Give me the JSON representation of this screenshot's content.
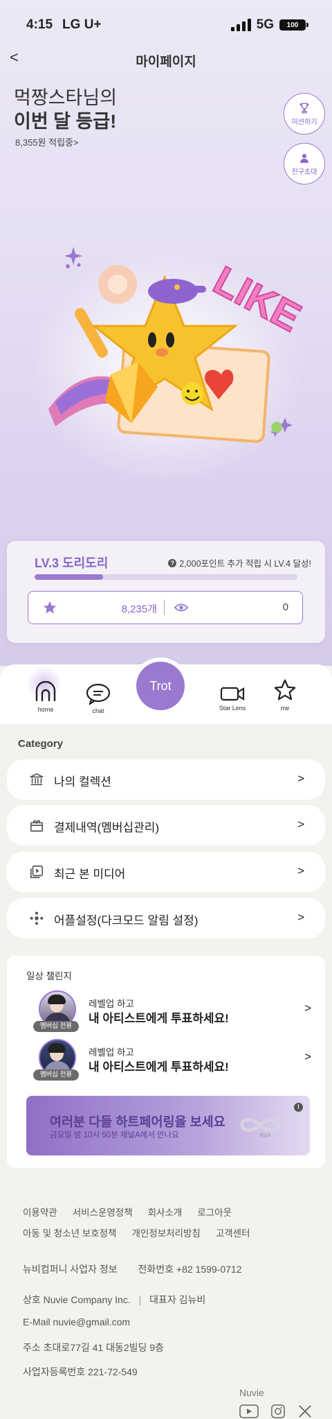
{
  "status_bar": {
    "time": "4:15",
    "carrier": "LG U+",
    "network": "5G",
    "battery": "100"
  },
  "header": {
    "back": "<",
    "title": "마이페이지"
  },
  "hero": {
    "greeting_line1": "먹짱스타님의",
    "greeting_line2": "이번 달 등급!",
    "points": "8,355원 적립중>",
    "mission_button": "미션하기",
    "invite_button": "친구초대"
  },
  "level": {
    "title": "LV.3 도리도리",
    "note": "2,000포인트 추가 적립 시 LV.4 달성!",
    "progress_fraction": 0.26,
    "star_count": "8,235개",
    "view_count": "0"
  },
  "tabbar": {
    "home": "home",
    "chat": "chat",
    "center": "Trot",
    "star_lens": "Star Lens",
    "me": "me"
  },
  "category": {
    "label": "Category",
    "items": [
      {
        "label": "나의 컬렉션",
        "arrow": ">"
      },
      {
        "label": "결제내역(멤버십관리)",
        "arrow": ">"
      },
      {
        "label": "최근 본 미디어",
        "arrow": ">"
      },
      {
        "label": "어플설정(다크모드 알림 설정)",
        "arrow": ">"
      }
    ]
  },
  "challenge": {
    "title": "일상 챌린지",
    "rows": [
      {
        "badge": "멤버십 전용",
        "sub": "레벨업 하고",
        "main": "내 아티스트에게 투표하세요!",
        "arrow": ">"
      },
      {
        "badge": "멤버십 전용",
        "sub": "레벨업 하고",
        "main": "내 아티스트에게 투표하세요!",
        "arrow": ">"
      }
    ],
    "banner": {
      "title": "여러분 다들 하트페어링을 보세요",
      "sub": "금요일 밤 10시 50분 채널A에서 만나요",
      "info": "!",
      "channel": "채널A"
    }
  },
  "footer": {
    "links_row1": [
      "이용약관",
      "서비스운영정책",
      "회사소개",
      "로그아웃"
    ],
    "links_row2": [
      "아동 및 청소년 보호정책",
      "개인정보처리방침",
      "고객센터"
    ],
    "company_info": "뉴비컴퍼니 사업자 정보",
    "phone": "전화번호 +82 1599-0712",
    "company_name": "상호 Nuvie Company Inc.",
    "ceo": "대표자 김뉴비",
    "email": "E-Mail nuvie@gmail.com",
    "address": "주소 초대로77길 41 대동2빌딩 9층",
    "biz_number": "사업자등록번호 221-72-549",
    "brand": "Nuvie"
  }
}
